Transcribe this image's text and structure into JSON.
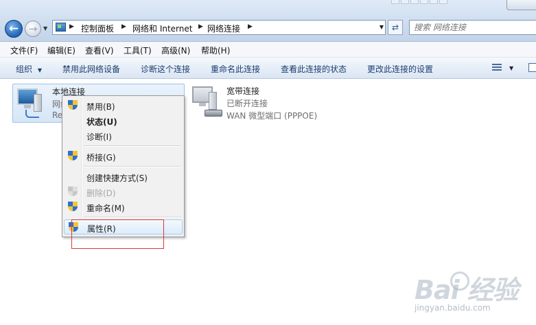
{
  "address_bar": {
    "breadcrumbs": [
      "控制面板",
      "网络和 Internet",
      "网络连接"
    ]
  },
  "search": {
    "placeholder": "搜索 网络连接"
  },
  "menu": [
    "文件(F)",
    "编辑(E)",
    "查看(V)",
    "工具(T)",
    "高级(N)",
    "帮助(H)"
  ],
  "toolbar": {
    "organize": "组织",
    "disable": "禁用此网络设备",
    "diagnose": "诊断这个连接",
    "rename": "重命名此连接",
    "view_status": "查看此连接的状态",
    "change_settings": "更改此连接的设置"
  },
  "connections": [
    {
      "name": "本地连接",
      "status": "网络",
      "device": "Re"
    },
    {
      "name": "宽带连接",
      "status": "已断开连接",
      "device": "WAN 微型端口 (PPPOE)"
    }
  ],
  "context_menu": {
    "disable": "禁用(B)",
    "status": "状态(U)",
    "diagnose": "诊断(I)",
    "bridge": "桥接(G)",
    "shortcut": "创建快捷方式(S)",
    "delete": "删除(D)",
    "rename": "重命名(M)",
    "properties": "属性(R)"
  },
  "watermark": {
    "logo": "Bai 经验",
    "url": "jingyan.baidu.com"
  },
  "colors": {
    "highlight_box": "#e0343a",
    "accent": "#2b6fbf"
  }
}
